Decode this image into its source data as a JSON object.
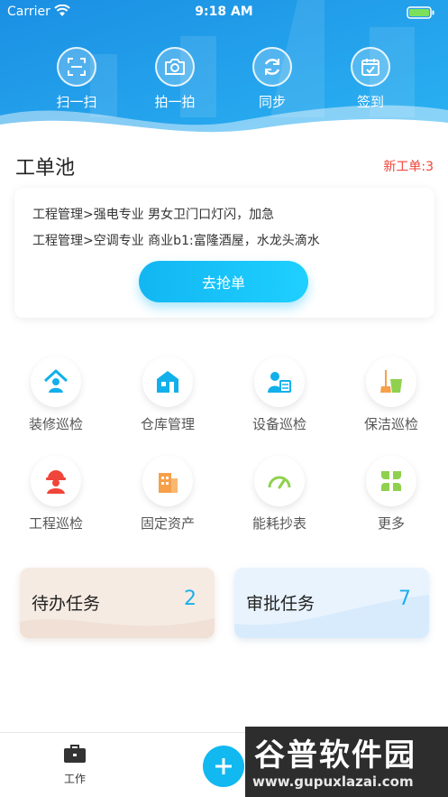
{
  "status_bar": {
    "carrier": "Carrier",
    "time": "9:18 AM"
  },
  "header_actions": [
    {
      "label": "扫一扫",
      "icon": "scan-icon"
    },
    {
      "label": "拍一拍",
      "icon": "camera-icon"
    },
    {
      "label": "同步",
      "icon": "sync-icon"
    },
    {
      "label": "签到",
      "icon": "check-in-icon"
    }
  ],
  "pool": {
    "title": "工单池",
    "new_orders": "新工单:3",
    "orders": [
      "工程管理>强电专业 男女卫门口灯闪，加急",
      "工程管理>空调专业 商业b1:富隆酒屋，水龙头滴水"
    ],
    "grab_label": "去抢单"
  },
  "grid": [
    {
      "label": "装修巡检",
      "icon": "house-person-icon",
      "color": "#12b0ea"
    },
    {
      "label": "仓库管理",
      "icon": "warehouse-icon",
      "color": "#12b0ea"
    },
    {
      "label": "设备巡检",
      "icon": "worker-inspect-icon",
      "color": "#12b0ea"
    },
    {
      "label": "保洁巡检",
      "icon": "bucket-mop-icon",
      "color": "#8fd14f"
    },
    {
      "label": "工程巡检",
      "icon": "engineer-helmet-icon",
      "color": "#f0453a"
    },
    {
      "label": "固定资产",
      "icon": "building-icon",
      "color": "#f6a04a"
    },
    {
      "label": "能耗抄表",
      "icon": "gauge-icon",
      "color": "#8fd14f"
    },
    {
      "label": "更多",
      "icon": "clover-icon",
      "color": "#8fd14f"
    }
  ],
  "tasks": {
    "todo": {
      "label": "待办任务",
      "count": "2"
    },
    "approve": {
      "label": "审批任务",
      "count": "7"
    }
  },
  "tabbar": {
    "work_label": "工作"
  },
  "watermark": {
    "brand": "谷普软件园",
    "url": "www.gupuxlazai.com"
  },
  "colors": {
    "accent": "#12b6f2",
    "header_blue": "#1d9be8",
    "alert_red": "#f0453a"
  }
}
